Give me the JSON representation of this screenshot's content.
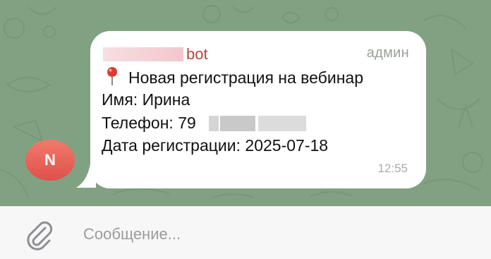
{
  "message": {
    "sender_visible": "bot",
    "role": "админ",
    "title": "Новая регистрация на вебинар",
    "name_line": "Имя: Ирина",
    "phone_prefix": "Телефон: 79",
    "date_line": "Дата регистрации: 2025-07-18",
    "time": "12:55"
  },
  "avatar": {
    "initial": "N",
    "color_top": "#f07a6b",
    "color_bottom": "#e0504a"
  },
  "composer": {
    "placeholder": "Сообщение..."
  },
  "colors": {
    "chat_background": "#81a282",
    "bubble": "#ffffff",
    "sender_name": "#b7443d",
    "meta_text": "#9aa19a"
  }
}
